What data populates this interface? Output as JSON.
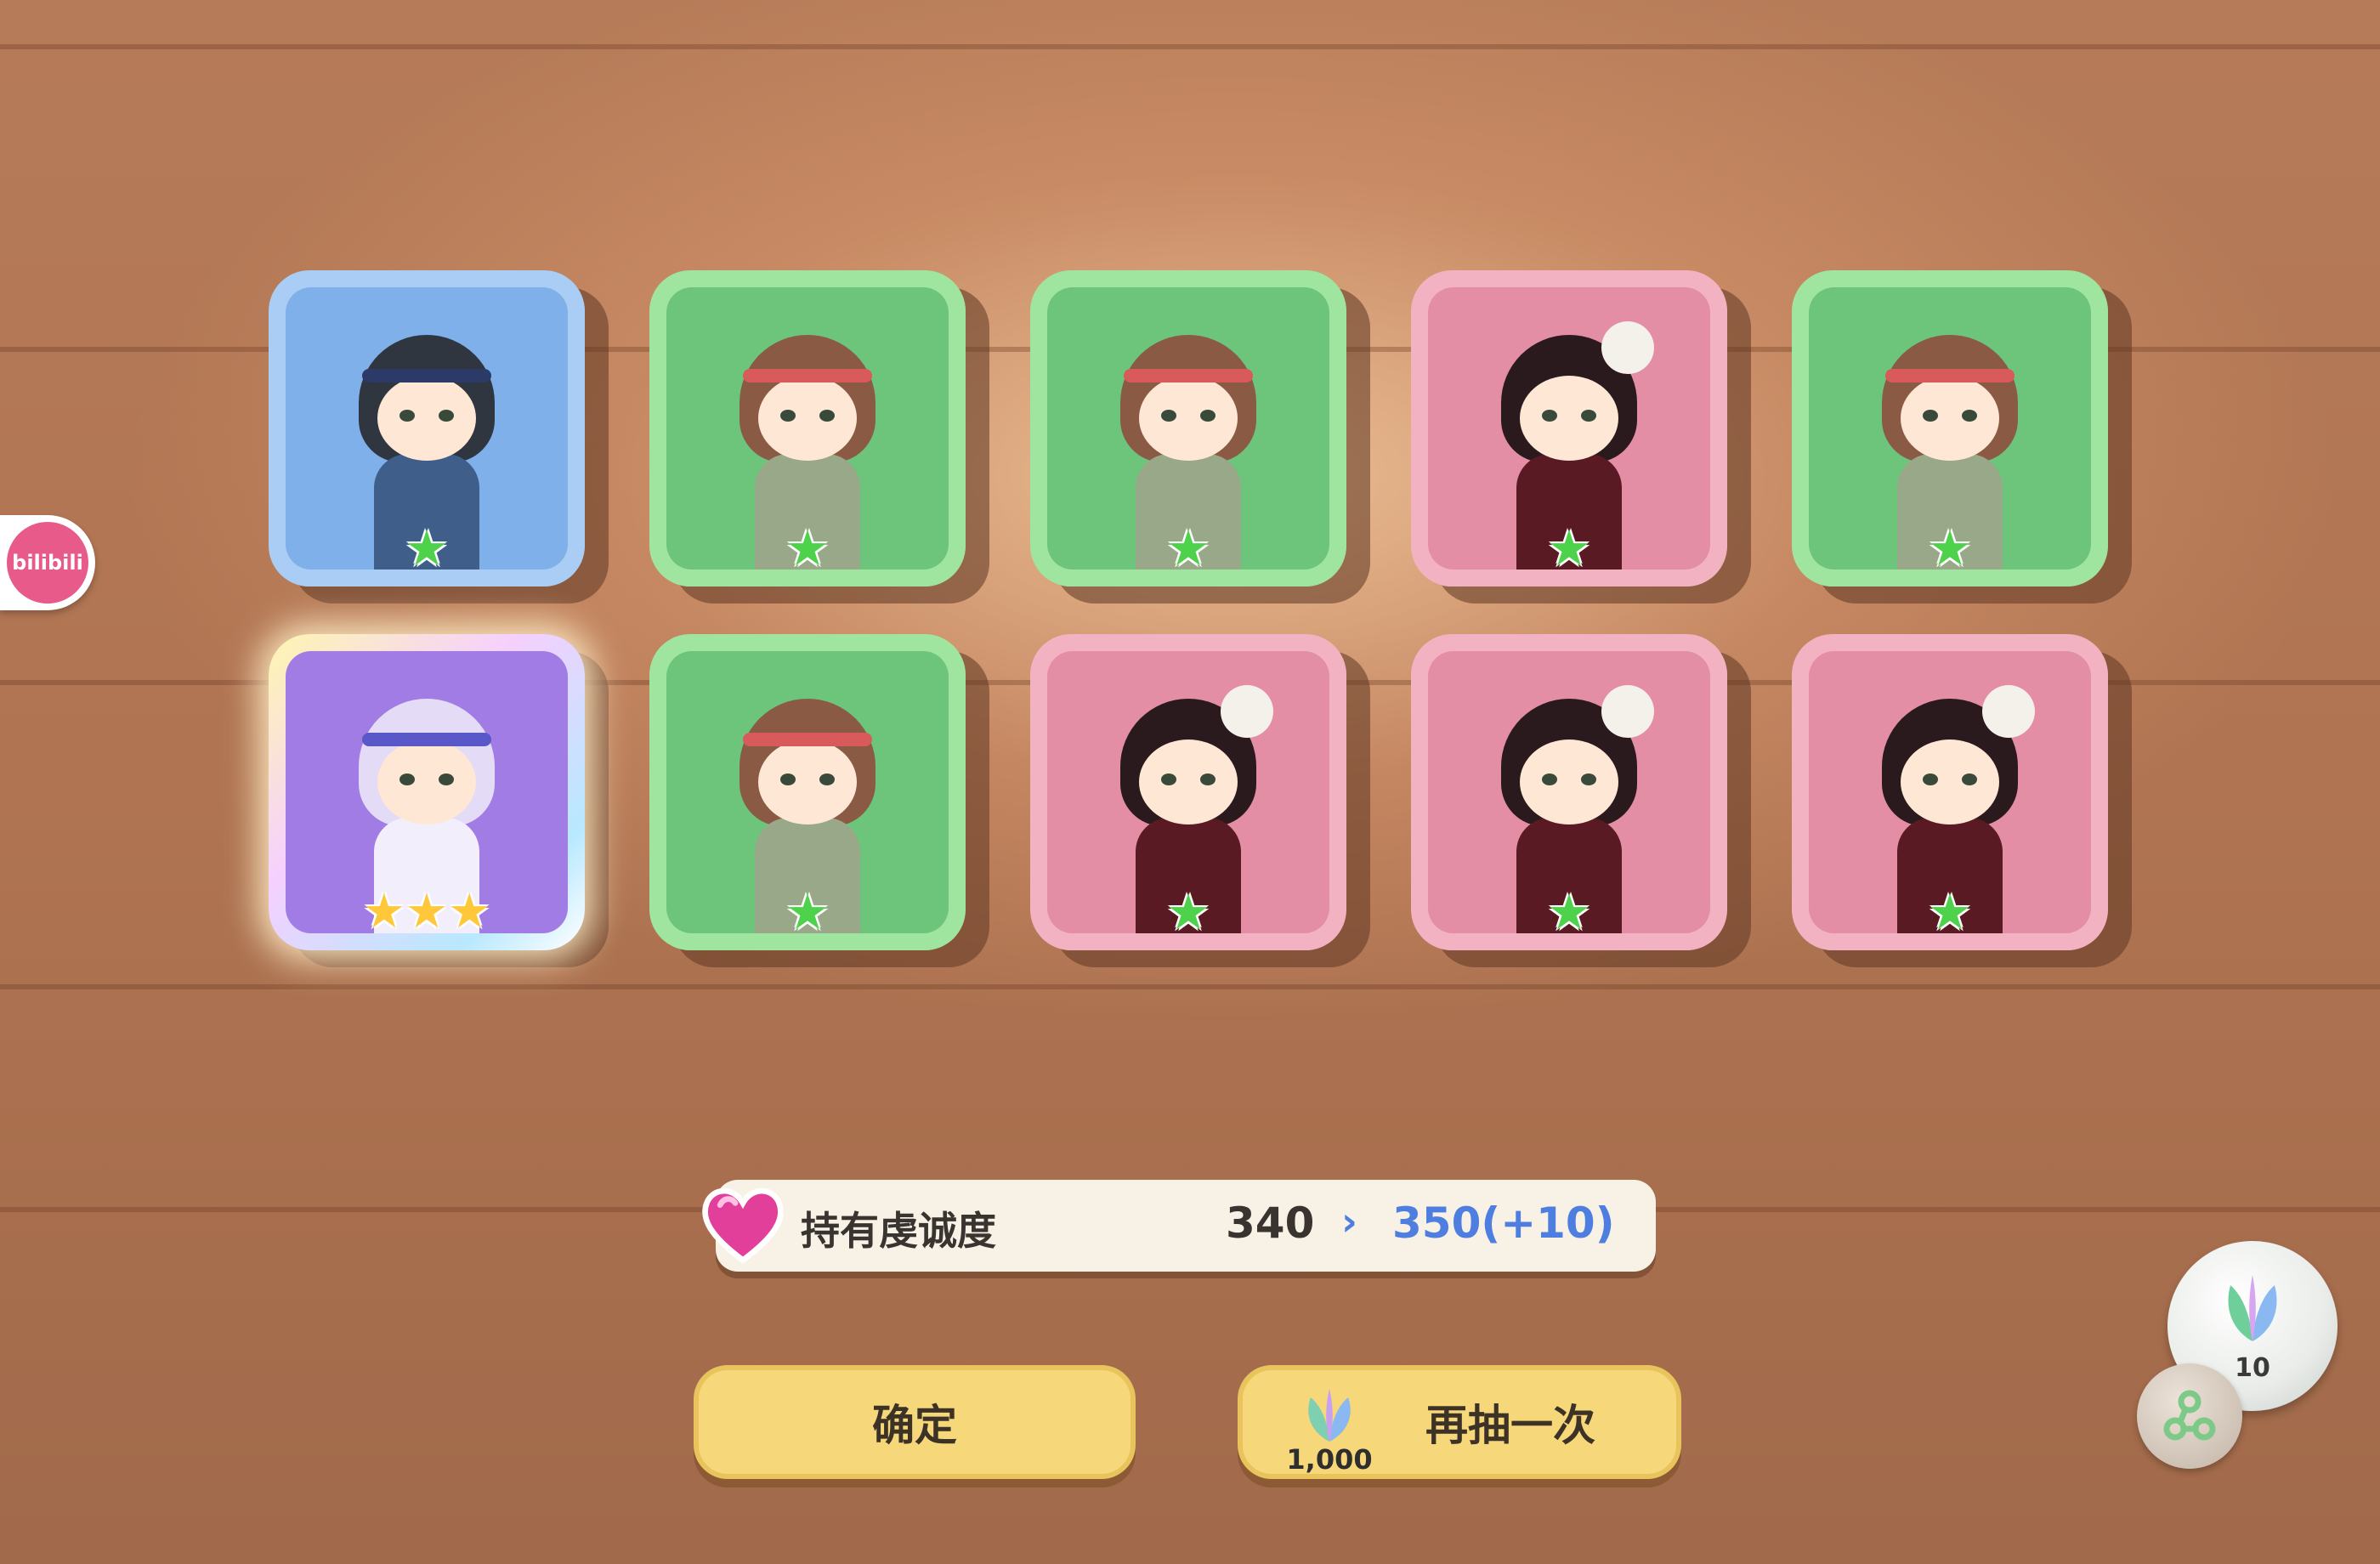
{
  "badge": {
    "label": "bilibili"
  },
  "cards": [
    {
      "rarity_color": "blue",
      "stars": 1,
      "character": "dark-hair-headband-girl",
      "icon": "character-portrait"
    },
    {
      "rarity_color": "green",
      "stars": 1,
      "character": "red-headband-girl",
      "icon": "character-portrait"
    },
    {
      "rarity_color": "green",
      "stars": 1,
      "character": "red-headband-girl",
      "icon": "character-portrait"
    },
    {
      "rarity_color": "pink",
      "stars": 1,
      "character": "skull-hairpin-girl",
      "icon": "character-portrait"
    },
    {
      "rarity_color": "green",
      "stars": 1,
      "character": "red-headband-girl",
      "icon": "character-portrait"
    },
    {
      "rarity_color": "purple",
      "stars": 3,
      "character": "white-hair-girl",
      "icon": "character-portrait"
    },
    {
      "rarity_color": "green",
      "stars": 1,
      "character": "red-headband-girl",
      "icon": "character-portrait"
    },
    {
      "rarity_color": "pink",
      "stars": 1,
      "character": "skull-hairpin-girl",
      "icon": "character-portrait"
    },
    {
      "rarity_color": "pink",
      "stars": 1,
      "character": "skull-hairpin-girl",
      "icon": "character-portrait"
    },
    {
      "rarity_color": "pink",
      "stars": 1,
      "character": "skull-hairpin-girl",
      "icon": "character-portrait"
    }
  ],
  "devotion": {
    "label": "持有虔诚度",
    "current": "340",
    "arrow": "›",
    "new_value": "350(+10)",
    "icon": "heart-icon"
  },
  "buttons": {
    "confirm": "确定",
    "draw_again": "再抽一次",
    "draw_cost": "1,000",
    "cost_icon": "gem-leaf-icon"
  },
  "currency": {
    "count": "10",
    "icon": "gem-leaf-icon"
  },
  "link_icon": "share-link-icon",
  "colors": {
    "blue": "#7fb0ea",
    "green": "#6cc57b",
    "pink": "#e48ea6",
    "purple": "#a07ce4",
    "button": "#f6d87a",
    "accent_text": "#4e7ee0"
  }
}
